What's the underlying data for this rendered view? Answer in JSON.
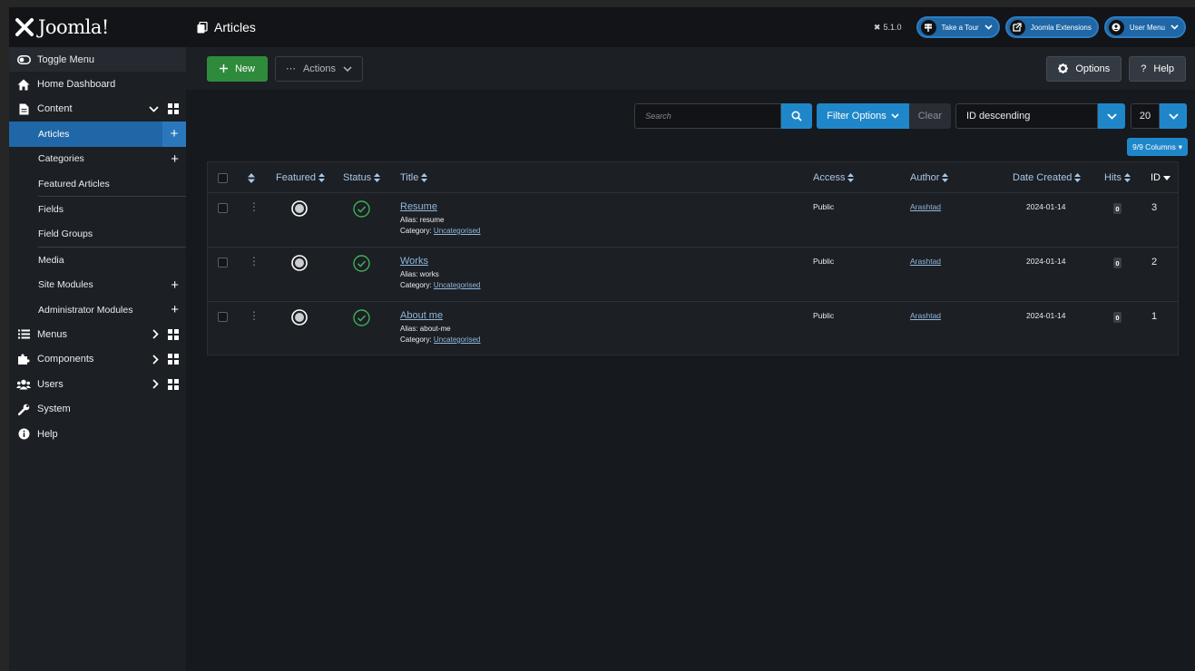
{
  "header": {
    "logo": "Joomla!",
    "page_title": "Articles",
    "version": "5.1.0",
    "take_tour": "Take a Tour",
    "extensions": "Joomla Extensions",
    "user_menu": "User Menu"
  },
  "sidebar": {
    "toggle": "Toggle Menu",
    "home": "Home Dashboard",
    "content": "Content",
    "sub": {
      "articles": "Articles",
      "categories": "Categories",
      "featured": "Featured Articles",
      "fields": "Fields",
      "field_groups": "Field Groups",
      "media": "Media",
      "site_modules": "Site Modules",
      "admin_modules": "Administrator Modules"
    },
    "menus": "Menus",
    "components": "Components",
    "users": "Users",
    "system": "System",
    "help": "Help"
  },
  "toolbar": {
    "new": "New",
    "actions": "Actions",
    "options": "Options",
    "help": "Help"
  },
  "filters": {
    "search_placeholder": "Search",
    "filter_options": "Filter Options",
    "clear": "Clear",
    "ordering": "ID descending",
    "limit": "20",
    "columns": "9/9 Columns"
  },
  "table": {
    "headers": {
      "featured": "Featured",
      "status": "Status",
      "title": "Title",
      "access": "Access",
      "author": "Author",
      "date": "Date Created",
      "hits": "Hits",
      "id": "ID"
    },
    "rows": [
      {
        "title": "Resume",
        "alias_label": "Alias:",
        "alias": "resume",
        "category_label": "Category:",
        "category": "Uncategorised",
        "access": "Public",
        "author": "Arashtad",
        "date": "2024-01-14",
        "hits": "0",
        "id": "3"
      },
      {
        "title": "Works",
        "alias_label": "Alias:",
        "alias": "works",
        "category_label": "Category:",
        "category": "Uncategorised",
        "access": "Public",
        "author": "Arashtad",
        "date": "2024-01-14",
        "hits": "0",
        "id": "2"
      },
      {
        "title": "About me",
        "alias_label": "Alias:",
        "alias": "about-me",
        "category_label": "Category:",
        "category": "Uncategorised",
        "access": "Public",
        "author": "Arashtad",
        "date": "2024-01-14",
        "hits": "0",
        "id": "1"
      }
    ]
  },
  "colors": {
    "accent": "#1f87c9",
    "active_nav": "#1f67a6",
    "new_button": "#2f8b3c",
    "published": "#3fae58"
  }
}
